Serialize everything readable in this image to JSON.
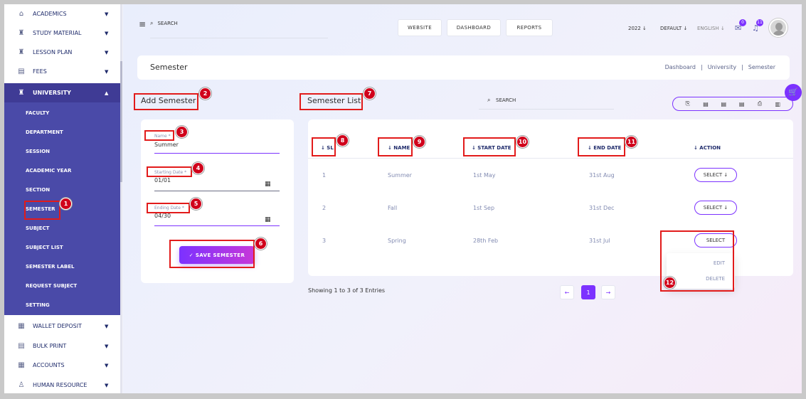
{
  "sidebar": {
    "items_top": [
      {
        "label": "ACADEMICS",
        "icon": "academics-icon",
        "glyph": "⌂"
      },
      {
        "label": "STUDY MATERIAL",
        "icon": "study-material-icon",
        "glyph": "♜"
      },
      {
        "label": "LESSON PLAN",
        "icon": "lesson-plan-icon",
        "glyph": "♜"
      },
      {
        "label": "FEES",
        "icon": "fees-icon",
        "glyph": "▤"
      }
    ],
    "active": {
      "label": "UNIVERSITY",
      "icon": "university-icon",
      "glyph": "♜"
    },
    "sub_items": [
      "FACULTY",
      "DEPARTMENT",
      "SESSION",
      "ACADEMIC YEAR",
      "SECTION",
      "SEMESTER",
      "SUBJECT",
      "SUBJECT LIST",
      "SEMESTER LABEL",
      "REQUEST SUBJECT",
      "SETTING"
    ],
    "items_bottom": [
      {
        "label": "WALLET DEPOSIT",
        "icon": "wallet-icon",
        "glyph": "▦"
      },
      {
        "label": "BULK PRINT",
        "icon": "bulk-print-icon",
        "glyph": "▤"
      },
      {
        "label": "ACCOUNTS",
        "icon": "accounts-icon",
        "glyph": "▦"
      },
      {
        "label": "HUMAN RESOURCE",
        "icon": "human-resource-icon",
        "glyph": "♙"
      }
    ]
  },
  "topbar": {
    "search_placeholder": "SEARCH",
    "buttons": [
      "WEBSITE",
      "DASHBOARD",
      "REPORTS"
    ],
    "year": "2022 ↓",
    "session": "DEFAULT ↓",
    "language": "ENGLISH ↓",
    "chat_badge": "0",
    "notif_badge": "11"
  },
  "header": {
    "title": "Semester",
    "breadcrumbs": [
      "Dashboard",
      "University",
      "Semester"
    ]
  },
  "form": {
    "title": "Add Semester",
    "name_label": "Name *",
    "name_value": "Summer",
    "start_label": "Starting Date *",
    "start_value": "01/01",
    "end_label": "Ending Date *",
    "end_value": "04/30",
    "save_label": "✓ SAVE SEMESTER"
  },
  "list": {
    "title": "Semester List",
    "search_placeholder": "SEARCH",
    "columns": [
      "↓ SL",
      "↓ NAME",
      "↓ START DATE",
      "↓ END DATE",
      "↓ ACTION"
    ],
    "rows": [
      {
        "sl": "1",
        "name": "Summer",
        "start": "1st May",
        "end": "31st Aug",
        "action": "SELECT ↓"
      },
      {
        "sl": "2",
        "name": "Fall",
        "start": "1st Sep",
        "end": "31st Dec",
        "action": "SELECT ↓"
      },
      {
        "sl": "3",
        "name": "Spring",
        "start": "28th Feb",
        "end": "31st Jul",
        "action": "SELECT"
      }
    ],
    "dropdown": [
      "EDIT",
      "DELETE"
    ],
    "entries": "Showing 1 to 3 of 3 Entries",
    "page": "1",
    "prev": "←",
    "next": "→"
  },
  "annotations": [
    "1",
    "2",
    "3",
    "4",
    "5",
    "6",
    "7",
    "8",
    "9",
    "10",
    "11",
    "12"
  ],
  "colors": {
    "accent": "#7c32ff",
    "sidebar_active": "#3f3b95",
    "submenu": "#4a4aa8",
    "annotation": "#e21b1b"
  }
}
